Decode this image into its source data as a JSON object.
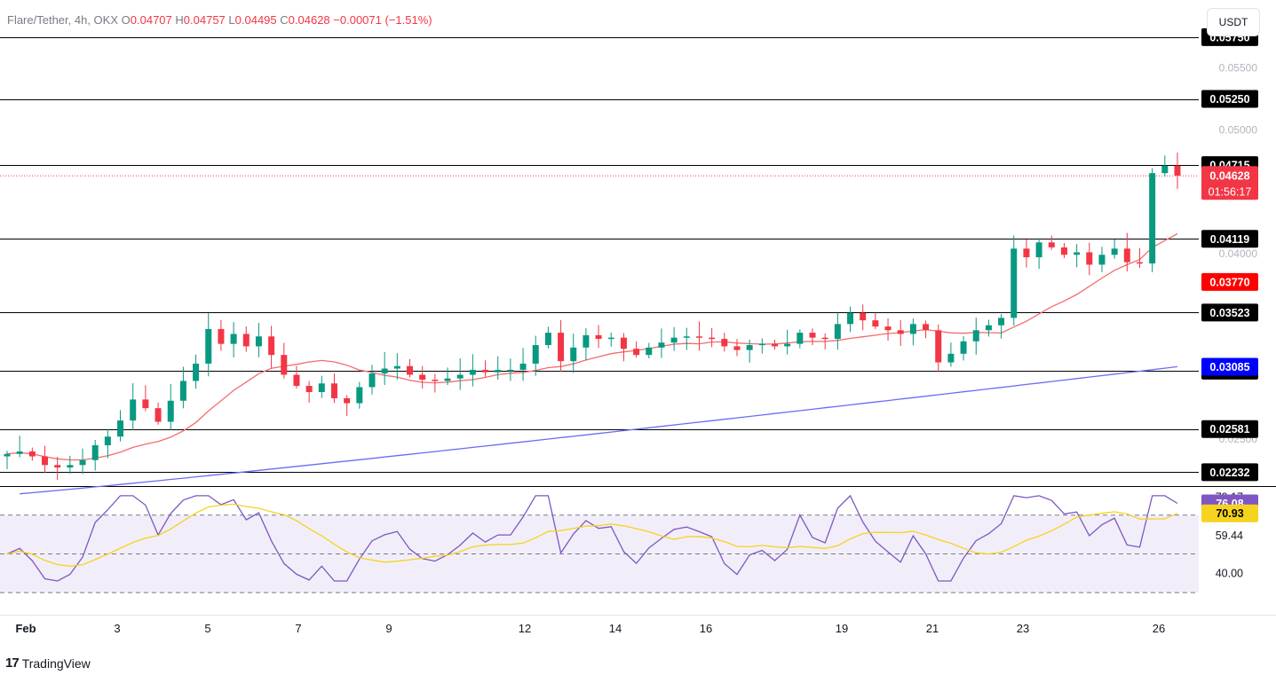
{
  "header": {
    "symbol": "Flare/Tether, 4h, OKX",
    "o_label": "O",
    "o_value": "0.04707",
    "h_label": "H",
    "h_value": "0.04757",
    "l_label": "L",
    "l_value": "0.04495",
    "c_label": "C",
    "c_value": "0.04628",
    "change": "−0.00071 (−1.51%)"
  },
  "unit_button": "USDT",
  "brand": {
    "name": "TradingView",
    "logo": "17"
  },
  "colors": {
    "up": "#089981",
    "down": "#f23645",
    "ma_fast": "#f26d6d",
    "ma_slow": "#6b6bf5",
    "rsi": "#7e57c2",
    "rsi_ma": "#f5d31e",
    "levels": "#000000"
  },
  "chart_data": [
    {
      "type": "candlestick",
      "title": "Flare/Tether, 4h, OKX",
      "ylim": [
        0.0212,
        0.0605
      ],
      "y_ticks": [
        "0.05500",
        "0.05000",
        "0.04000",
        "0.02500"
      ],
      "x_ticks": [
        "Feb",
        "3",
        "5",
        "7",
        "9",
        "12",
        "14",
        "16",
        "19",
        "21",
        "23",
        "26"
      ],
      "last_price": "0.04628",
      "countdown": "01:56:17",
      "levels": [
        {
          "value": 0.0575,
          "label": "0.05750"
        },
        {
          "value": 0.0525,
          "label": "0.05250"
        },
        {
          "value": 0.04715,
          "label": "0.04715"
        },
        {
          "value": 0.04119,
          "label": "0.04119"
        },
        {
          "value": 0.03523,
          "label": "0.03523"
        },
        {
          "value": 0.03053,
          "label": "0.03053"
        },
        {
          "value": 0.02581,
          "label": "0.02581"
        },
        {
          "value": 0.02232,
          "label": "0.02232"
        }
      ],
      "ma_labels": [
        {
          "value": 0.0377,
          "label": "0.03770",
          "series": "ma_fast"
        },
        {
          "value": 0.03085,
          "label": "0.03085",
          "series": "ma_slow"
        }
      ],
      "closes": [
        0.0238,
        0.024,
        0.0236,
        0.0229,
        0.0227,
        0.0229,
        0.0233,
        0.0245,
        0.0252,
        0.0265,
        0.0282,
        0.0275,
        0.0264,
        0.0281,
        0.0297,
        0.0311,
        0.0339,
        0.0327,
        0.0335,
        0.0325,
        0.0333,
        0.0318,
        0.0302,
        0.0293,
        0.0288,
        0.0295,
        0.0283,
        0.0279,
        0.0292,
        0.0303,
        0.0307,
        0.0309,
        0.0302,
        0.0298,
        0.0297,
        0.0299,
        0.0302,
        0.0306,
        0.0304,
        0.0306,
        0.0306,
        0.0311,
        0.0326,
        0.0336,
        0.0313,
        0.0324,
        0.0334,
        0.0331,
        0.0332,
        0.0323,
        0.0318,
        0.0324,
        0.0328,
        0.0332,
        0.0333,
        0.0332,
        0.0331,
        0.0325,
        0.0322,
        0.0326,
        0.0327,
        0.0325,
        0.0327,
        0.0336,
        0.0332,
        0.0331,
        0.0343,
        0.0352,
        0.0346,
        0.0341,
        0.0338,
        0.0335,
        0.0343,
        0.0338,
        0.0312,
        0.0319,
        0.0329,
        0.0338,
        0.0342,
        0.0348,
        0.0404,
        0.0397,
        0.0409,
        0.0405,
        0.0399,
        0.0401,
        0.0391,
        0.0399,
        0.0404,
        0.0393,
        0.0392,
        0.0465,
        0.0471,
        0.0463
      ],
      "series": [
        {
          "name": "MA fast",
          "last": 0.0377
        },
        {
          "name": "MA slow",
          "last": 0.03085
        }
      ]
    },
    {
      "type": "line",
      "title": "RSI",
      "ylim": [
        20,
        85
      ],
      "y_ticks": [
        "79.17",
        "59.44",
        "40.00"
      ],
      "bands": [
        30,
        50,
        70
      ],
      "rsi_value": "76.08",
      "rsi_ma_value": "70.93"
    }
  ]
}
